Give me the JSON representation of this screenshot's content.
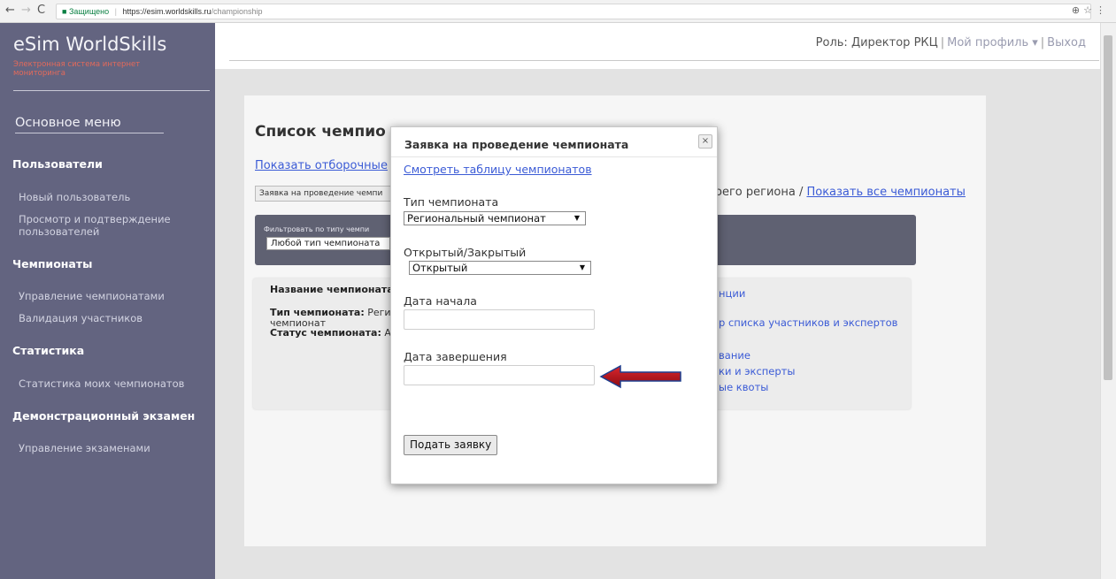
{
  "browser": {
    "secure_label": "Защищено",
    "url_host": "https://esim.worldskills.ru",
    "url_path": "/championship"
  },
  "sidebar": {
    "brand": "eSim WorldSkills",
    "brand_sub": "Электронная система интернет мониторинга",
    "main_menu": "Основное меню",
    "sections": [
      {
        "title": "Пользователи",
        "items": [
          "Новый пользователь",
          "Просмотр и подтверждение пользователей"
        ]
      },
      {
        "title": "Чемпионаты",
        "items": [
          "Управление чемпионатами",
          "Валидация участников"
        ]
      },
      {
        "title": "Статистика",
        "items": [
          "Статистика моих чемпионатов"
        ]
      },
      {
        "title": "Демонстрационный экзамен",
        "items": [
          "Управление экзаменами"
        ]
      }
    ]
  },
  "header": {
    "role": "Роль: Директор РКЦ",
    "profile": "Мой профиль ▾",
    "logout": "Выход"
  },
  "main": {
    "title": "Список чемпио",
    "show_link": "Показать отборочные",
    "request_button": "Заявка на проведение чемпи",
    "region_text": "оего региона /",
    "show_all": "Показать все чемпионаты",
    "filter_label": "Фильтровать по типу чемпи",
    "filter_value": "Любой тип чемпионата",
    "card": {
      "name_label": "Название чемпионата",
      "type_label": "Тип чемпионата:",
      "type_value": "Реги",
      "type_value2": "чемпионат",
      "status_label": "Статус чемпионата:",
      "status_value": "А",
      "links": [
        "нции",
        "р списка участников и экспертов",
        "вание",
        "ки и эксперты",
        "ые квоты"
      ]
    }
  },
  "modal": {
    "title": "Заявка на проведение чемпионата",
    "close": "×",
    "view_table": "Смотреть таблицу чемпионатов",
    "type_label": "Тип чемпионата",
    "type_value": "Региональный чемпионат",
    "open_label": "Открытый/Закрытый",
    "open_value": "Открытый",
    "start_label": "Дата начала",
    "end_label": "Дата завершения",
    "submit": "Подать заявку"
  },
  "colors": {
    "sidebar_bg": "#636480",
    "accent_link": "#3b5bd6",
    "brand_sub": "#e46a5a",
    "arrow": "#b5121b"
  }
}
